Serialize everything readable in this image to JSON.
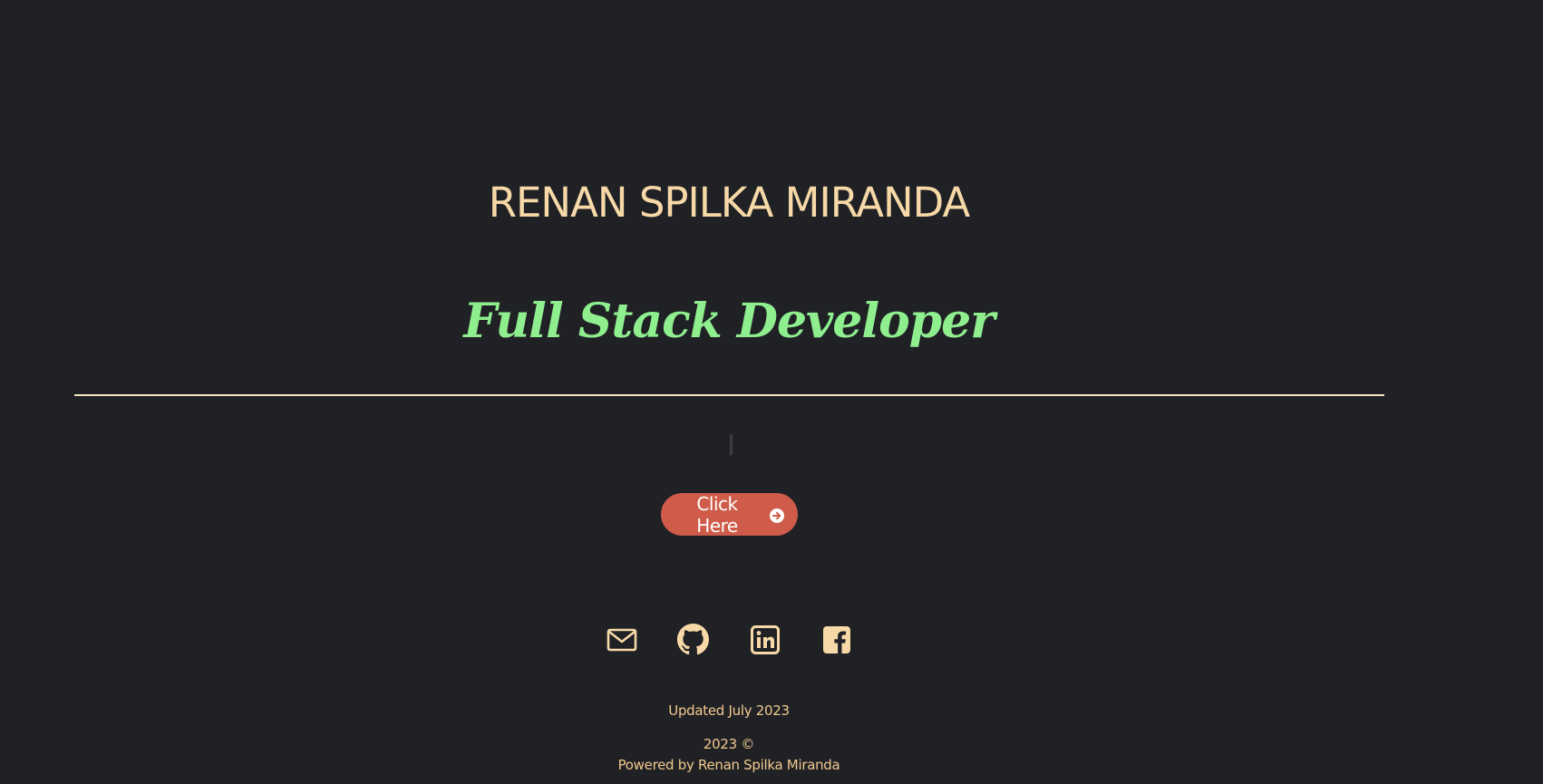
{
  "hero": {
    "name": "RENAN SPILKA MIRANDA",
    "role": "Full Stack Developer"
  },
  "cta": {
    "label": "Click Here",
    "icon": "arrow-circle-right-icon"
  },
  "socials": [
    {
      "name": "email",
      "icon": "mail-icon"
    },
    {
      "name": "github",
      "icon": "github-icon"
    },
    {
      "name": "linkedin",
      "icon": "linkedin-icon"
    },
    {
      "name": "facebook",
      "icon": "facebook-icon"
    }
  ],
  "footer": {
    "updated": "Updated July 2023",
    "copyright": "2023 ©",
    "powered_by": "Powered by Renan Spilka Miranda"
  },
  "colors": {
    "background": "#202125",
    "name": "#f7d9a8",
    "role": "#8fef8f",
    "accent_button": "#cf5c4a",
    "footer_text": "#f2c98e"
  }
}
